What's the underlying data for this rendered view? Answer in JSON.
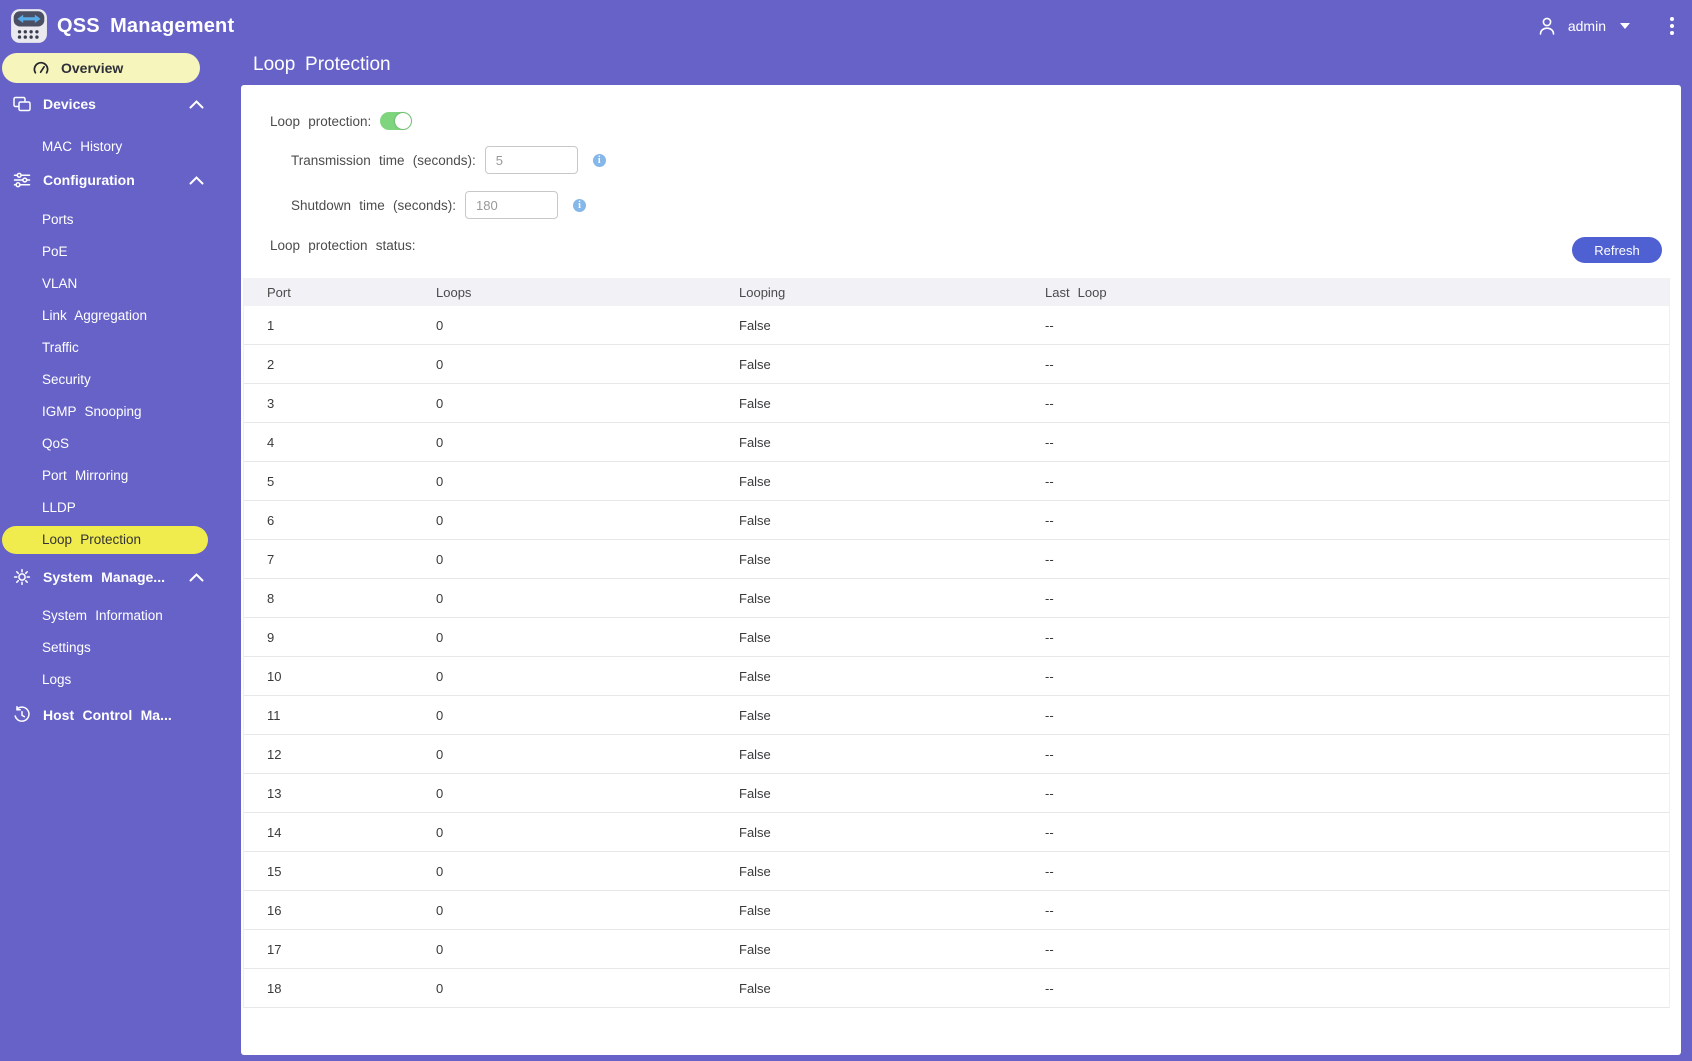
{
  "app": {
    "title": "QSS Management"
  },
  "topbar": {
    "user_label": "admin"
  },
  "sidebar": {
    "overview_label": "Overview",
    "active_item": "Loop Protection",
    "groups": [
      {
        "label": "Devices",
        "icon": "devices-icon",
        "items": [
          "MAC History"
        ]
      },
      {
        "label": "Configuration",
        "icon": "sliders-icon",
        "items": [
          "Ports",
          "PoE",
          "VLAN",
          "Link Aggregation",
          "Traffic",
          "Security",
          "IGMP Snooping",
          "QoS",
          "Port Mirroring",
          "LLDP",
          "Loop Protection"
        ]
      },
      {
        "label": "System Manage...",
        "icon": "gear-icon",
        "items": [
          "System Information",
          "Settings",
          "Logs"
        ]
      }
    ],
    "host_label": "Host Control Ma..."
  },
  "page": {
    "title": "Loop Protection",
    "form": {
      "toggle_label": "Loop protection:",
      "toggle_state": "on",
      "transmission_label": "Transmission time (seconds):",
      "transmission_value": "5",
      "shutdown_label": "Shutdown time (seconds):",
      "shutdown_value": "180",
      "status_label": "Loop protection status:"
    },
    "refresh_label": "Refresh",
    "table": {
      "columns": [
        "Port",
        "Loops",
        "Looping",
        "Last Loop"
      ],
      "rows": [
        [
          "1",
          "0",
          "False",
          "--"
        ],
        [
          "2",
          "0",
          "False",
          "--"
        ],
        [
          "3",
          "0",
          "False",
          "--"
        ],
        [
          "4",
          "0",
          "False",
          "--"
        ],
        [
          "5",
          "0",
          "False",
          "--"
        ],
        [
          "6",
          "0",
          "False",
          "--"
        ],
        [
          "7",
          "0",
          "False",
          "--"
        ],
        [
          "8",
          "0",
          "False",
          "--"
        ],
        [
          "9",
          "0",
          "False",
          "--"
        ],
        [
          "10",
          "0",
          "False",
          "--"
        ],
        [
          "11",
          "0",
          "False",
          "--"
        ],
        [
          "12",
          "0",
          "False",
          "--"
        ],
        [
          "13",
          "0",
          "False",
          "--"
        ],
        [
          "14",
          "0",
          "False",
          "--"
        ],
        [
          "15",
          "0",
          "False",
          "--"
        ],
        [
          "16",
          "0",
          "False",
          "--"
        ],
        [
          "17",
          "0",
          "False",
          "--"
        ],
        [
          "18",
          "0",
          "False",
          "--"
        ]
      ]
    }
  },
  "colors": {
    "page_purple": "#6762c8",
    "active_item_yellow": "#f0ec4e",
    "overview_pill_yellow": "#f6f6bc",
    "toggle_green": "#7ed57e",
    "refresh_blue": "#4f60d2",
    "info_icon_blue": "#86b7ea",
    "table_header_gray": "#f1f1f6"
  }
}
